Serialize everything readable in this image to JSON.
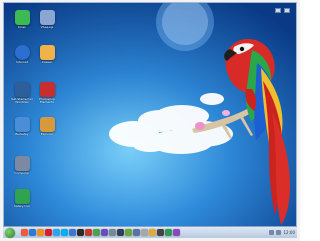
{
  "desktop": {
    "icons": [
      {
        "label": "Kiosk",
        "icon": "user-green-icon",
        "color": "#3cba54"
      },
      {
        "label": "Vbaqsqs",
        "icon": "folder-icon",
        "color": "#8aa7d4"
      },
      {
        "label": "Internet",
        "icon": "globe-icon",
        "color": "#2b6fd1"
      },
      {
        "label": "Caesar",
        "icon": "folder-amber-icon",
        "color": "#f0b24a"
      },
      {
        "label": "Get Started w/ Windows",
        "icon": "windows-icon",
        "color": "#2f5f9a"
      },
      {
        "label": "Photoshop Elements",
        "icon": "red-app-icon",
        "color": "#c92d2d"
      },
      {
        "label": "BioSafey",
        "icon": "shield-icon",
        "color": "#4a8ed8"
      },
      {
        "label": "Explorer",
        "icon": "folder-icon",
        "color": "#d59a3f"
      },
      {
        "label": "Computer",
        "icon": "monitor-icon",
        "color": "#7b8aa2"
      },
      {
        "label": "Safety tool",
        "icon": "app-icon",
        "color": "#2fa34e"
      }
    ]
  },
  "taskbar": {
    "start_icon": "windows-orb-icon",
    "apps": [
      {
        "icon": "chrome-icon",
        "color": "#f05a3b"
      },
      {
        "icon": "ie-icon",
        "color": "#2b7ad8"
      },
      {
        "icon": "firefox-icon",
        "color": "#f28f23"
      },
      {
        "icon": "opera-icon",
        "color": "#d71f2a"
      },
      {
        "icon": "safari-icon",
        "color": "#2ba5ef"
      },
      {
        "icon": "skype-icon",
        "color": "#00aff0"
      },
      {
        "icon": "mail-icon",
        "color": "#3a78d8"
      },
      {
        "icon": "media-icon",
        "color": "#2b2b2b"
      },
      {
        "icon": "flash-icon",
        "color": "#c43a2b"
      },
      {
        "icon": "photo-icon",
        "color": "#4aa34a"
      },
      {
        "icon": "chat-icon",
        "color": "#6a4cc2"
      },
      {
        "icon": "tools-icon",
        "color": "#778899"
      },
      {
        "icon": "steam-icon",
        "color": "#2f3f58"
      },
      {
        "icon": "leaf-icon",
        "color": "#69a93a"
      },
      {
        "icon": "search-icon",
        "color": "#5674a8"
      },
      {
        "icon": "settings-icon",
        "color": "#a7a7a7"
      },
      {
        "icon": "folder-icon",
        "color": "#e2a93b"
      },
      {
        "icon": "camera-icon",
        "color": "#444444"
      },
      {
        "icon": "player-icon",
        "color": "#2c9c53"
      },
      {
        "icon": "app-icon",
        "color": "#8d46c3"
      }
    ],
    "tray_text": "12:00"
  },
  "colors": {
    "sky_top": "#0b3f8f",
    "sky_bottom": "#5ec3ff",
    "parrot_red": "#d82b28",
    "parrot_green": "#2aa64b"
  }
}
